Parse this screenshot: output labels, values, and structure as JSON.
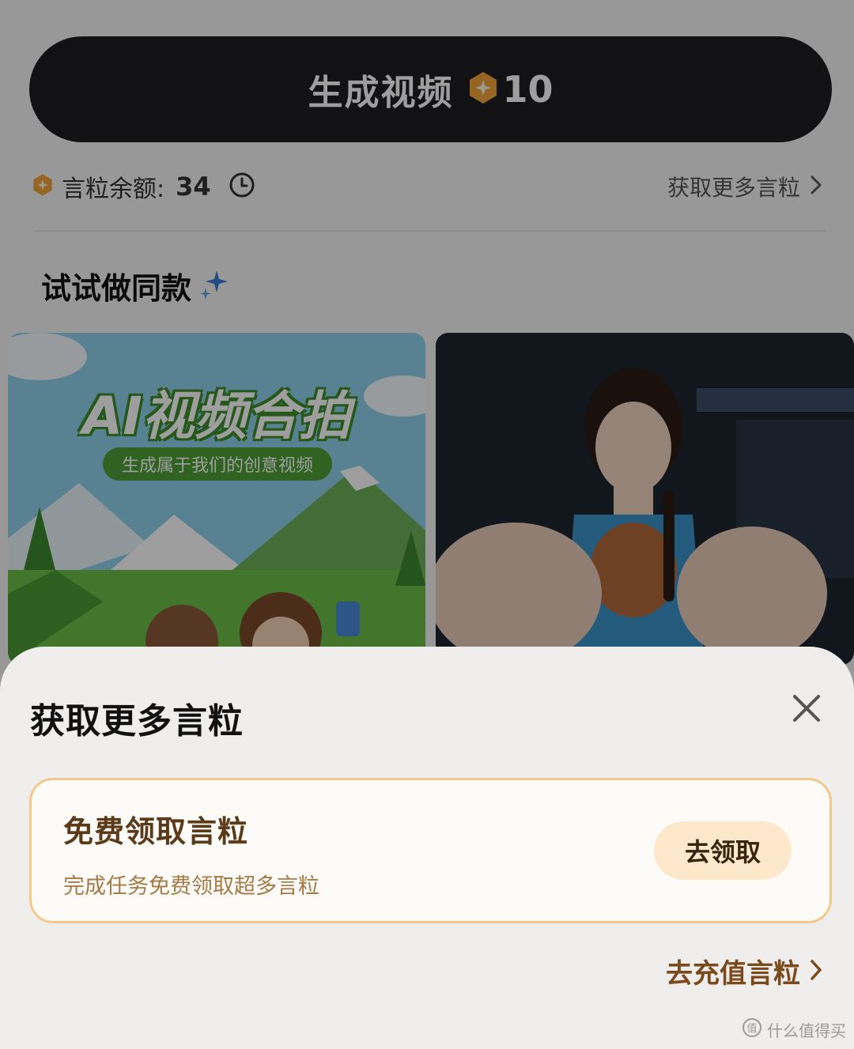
{
  "background": {
    "generate_button": {
      "label": "生成视频",
      "cost": "10"
    },
    "balance": {
      "label": "言粒余额:",
      "value": "34"
    },
    "more_link": {
      "label": "获取更多言粒"
    },
    "section_title": "试试做同款",
    "cards": [
      {
        "title": "AI视频合拍",
        "subtitle": "生成属于我们的创意视频"
      },
      {
        "title": ""
      }
    ]
  },
  "sheet": {
    "title": "获取更多言粒",
    "free_card": {
      "title": "免费领取言粒",
      "description": "完成任务免费领取超多言粒",
      "button_label": "去领取"
    },
    "recharge_link": "去充值言粒"
  },
  "watermark": "什么值得买",
  "icons": {
    "coin": "coin-icon",
    "clock": "clock-icon",
    "chevron": "chevron-right-icon",
    "sparkle": "sparkle-icon",
    "close": "close-icon"
  },
  "colors": {
    "accent_orange": "#f2a33a",
    "card_border": "#f2c98a",
    "primary_dark": "#1d1d22",
    "sheet_background": "#efeeed"
  }
}
